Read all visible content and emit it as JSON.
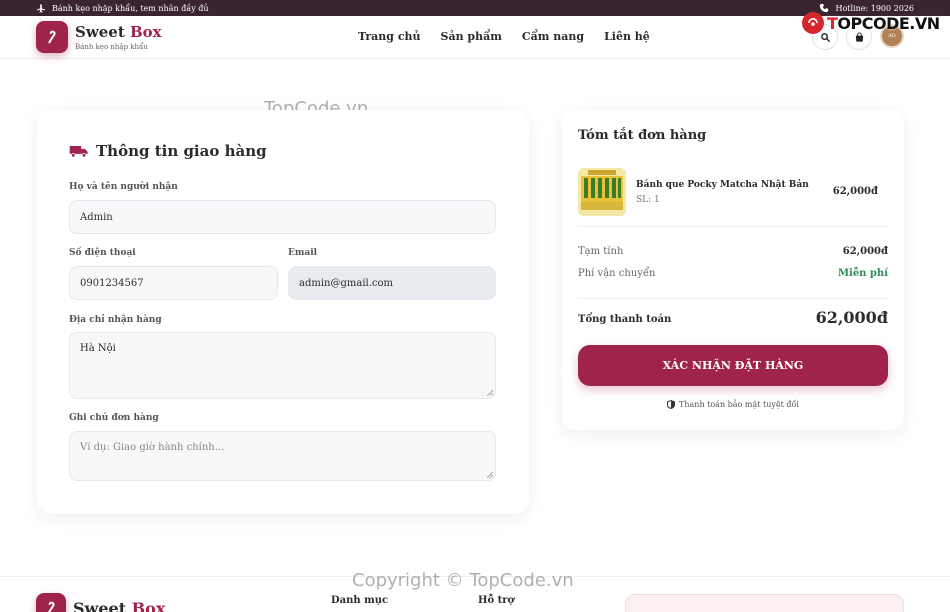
{
  "topbar": {
    "promo": "Bánh kẹo nhập khẩu, tem nhãn đầy đủ",
    "hotline": "Hotline: 1900 2026"
  },
  "brand": {
    "name": "Sweet",
    "name_accent": "Box",
    "tagline": "Bánh kẹo nhập khẩu"
  },
  "nav": [
    "Trang chủ",
    "Sản phẩm",
    "Cẩm nang",
    "Liên hệ"
  ],
  "header_icons": [
    "search-icon",
    "bag-icon",
    "avatar"
  ],
  "avatar_label": "AD",
  "watermark": {
    "badge_pre": "T",
    "badge_main": "OPCODE.VN",
    "top": "TopCode.vn",
    "bottom": "Copyright © TopCode.vn"
  },
  "shipping": {
    "title": "Thông tin giao hàng",
    "name_label": "Họ và tên người nhận",
    "name_value": "Admin",
    "phone_label": "Số điện thoại",
    "phone_value": "0901234567",
    "email_label": "Email",
    "email_value": "admin@gmail.com",
    "address_label": "Địa chỉ nhận hàng",
    "address_value": "Hà Nội",
    "note_label": "Ghi chú đơn hàng",
    "note_placeholder": "Ví dụ: Giao giờ hành chính..."
  },
  "summary": {
    "title": "Tóm tắt đơn hàng",
    "item": {
      "name": "Bánh que Pocky Matcha Nhật Bản",
      "qty": "SL: 1",
      "price": "62,000đ"
    },
    "subtotal_label": "Tạm tính",
    "subtotal_value": "62,000đ",
    "shipping_label": "Phí vận chuyển",
    "shipping_value": "Miễn phí",
    "total_label": "Tổng thanh toán",
    "total_value": "62,000đ",
    "confirm_label": "XÁC NHẬN ĐẶT HÀNG",
    "secure_note": "Thanh toán bảo mật tuyệt đối"
  },
  "footer": {
    "brand_name": "Sweet",
    "brand_accent": "Box",
    "col1": "Danh mục",
    "col2": "Hỗ trợ"
  },
  "colors": {
    "accent": "#a0244a",
    "topbar": "#3a2430",
    "free": "#2e8b57"
  }
}
